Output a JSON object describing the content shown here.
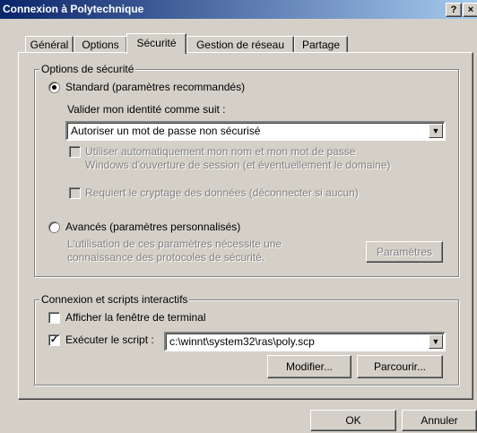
{
  "window": {
    "title": "Connexion à Polytechnique",
    "help_glyph": "?",
    "close_glyph": "×"
  },
  "tabs": [
    {
      "label": "Général"
    },
    {
      "label": "Options"
    },
    {
      "label": "Sécurité",
      "active": true
    },
    {
      "label": "Gestion de réseau"
    },
    {
      "label": "Partage"
    }
  ],
  "security": {
    "legend": "Options de sécurité",
    "standard_label": "Standard (paramètres recommandés)",
    "validate_label": "Valider mon identité comme suit :",
    "identity_select": "Autoriser un mot de passe non sécurisé",
    "autologon_line1": "Utiliser automatiquement mon nom et mon mot de passe",
    "autologon_line2": "Windows d'ouverture de session (et éventuellement le domaine)",
    "encryption_label": "Requiert le cryptage des données (déconnecter si aucun)",
    "advanced_label": "Avancés (paramètres personnalisés)",
    "advanced_note_line1": "L'utilisation de ces paramètres nécessite une",
    "advanced_note_line2": "connaissance des protocoles de sécurité.",
    "params_button": "Paramètres"
  },
  "scripts": {
    "legend": "Connexion et scripts interactifs",
    "terminal_label": "Afficher la fenêtre de terminal",
    "run_script_label": "Exécuter le script :",
    "script_path": "c:\\winnt\\system32\\ras\\poly.scp",
    "modify_button": "Modifier...",
    "browse_button": "Parcourir..."
  },
  "footer": {
    "ok_button": "OK",
    "cancel_button": "Annuler"
  }
}
